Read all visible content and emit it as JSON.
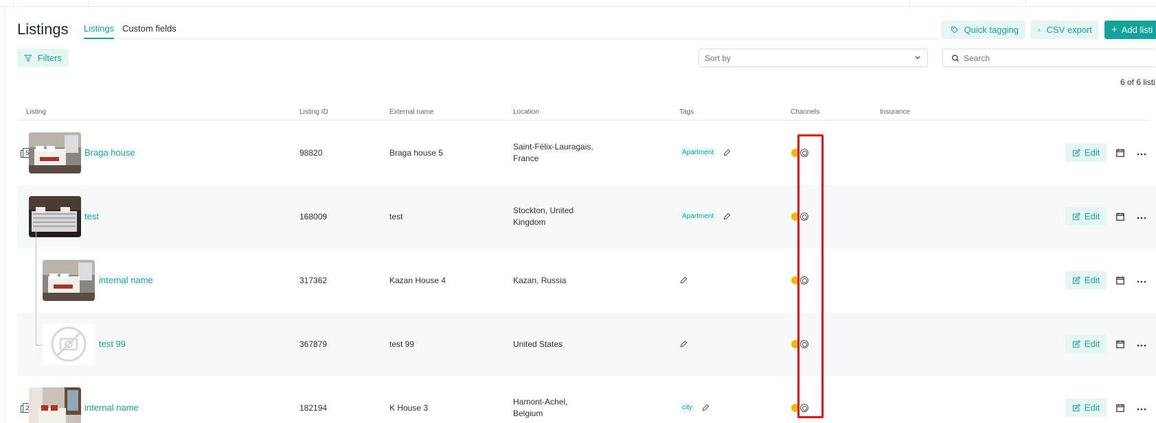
{
  "page": {
    "title": "Listings"
  },
  "tabs": [
    {
      "label": "Listings",
      "active": true
    },
    {
      "label": "Custom fields",
      "active": false
    }
  ],
  "toolbar": {
    "quick_tagging": "Quick tagging",
    "csv_export": "CSV export",
    "add_listing": "Add listi"
  },
  "filters": {
    "label": "Filters"
  },
  "sort": {
    "placeholder": "Sort by"
  },
  "search": {
    "placeholder": "Search"
  },
  "count": {
    "text": "6 of 6 listi"
  },
  "table": {
    "headers": {
      "listing": "Listing",
      "listing_id": "Listing ID",
      "external_name": "External name",
      "location": "Location",
      "tags": "Tags",
      "channels": "Channels",
      "insurance": "Insurance"
    },
    "edit_label": "Edit",
    "rows": [
      {
        "name": "Braga house",
        "photo_count": "5",
        "listing_id": "98820",
        "external_name": "Braga house 5",
        "location_line1": "Saint-Félix-Lauragais,",
        "location_line2": "France",
        "tag": "Apartment",
        "channels": [
          "airbnb-icon",
          "guesty-icon"
        ]
      },
      {
        "name": "test",
        "photo_count": "",
        "listing_id": "168009",
        "external_name": "test",
        "location_line1": "Stockton, United",
        "location_line2": "Kingdom",
        "tag": "Apartment",
        "channels": [
          "airbnb-icon",
          "guesty-icon"
        ]
      },
      {
        "name": "internal name",
        "photo_count": "",
        "listing_id": "317362",
        "external_name": "Kazan House 4",
        "location_line1": "Kazan, Russia",
        "location_line2": "",
        "tag": "",
        "channels": [
          "airbnb-icon",
          "guesty-icon"
        ]
      },
      {
        "name": "test 99",
        "photo_count": "",
        "listing_id": "367879",
        "external_name": "test 99",
        "location_line1": "United States",
        "location_line2": "",
        "tag": "",
        "channels": [
          "airbnb-icon",
          "guesty-icon"
        ]
      },
      {
        "name": "internal name",
        "photo_count": "2",
        "listing_id": "182194",
        "external_name": "K House 3",
        "location_line1": "Hamont-Achel,",
        "location_line2": "Belgium",
        "tag": "city",
        "channels": [
          "airbnb-icon",
          "guesty-icon"
        ]
      }
    ]
  },
  "colors": {
    "accent": "#14a39a",
    "accent_soft": "#e4f5f3",
    "highlight": "#e0151b",
    "airbnb": "#f2b705"
  }
}
